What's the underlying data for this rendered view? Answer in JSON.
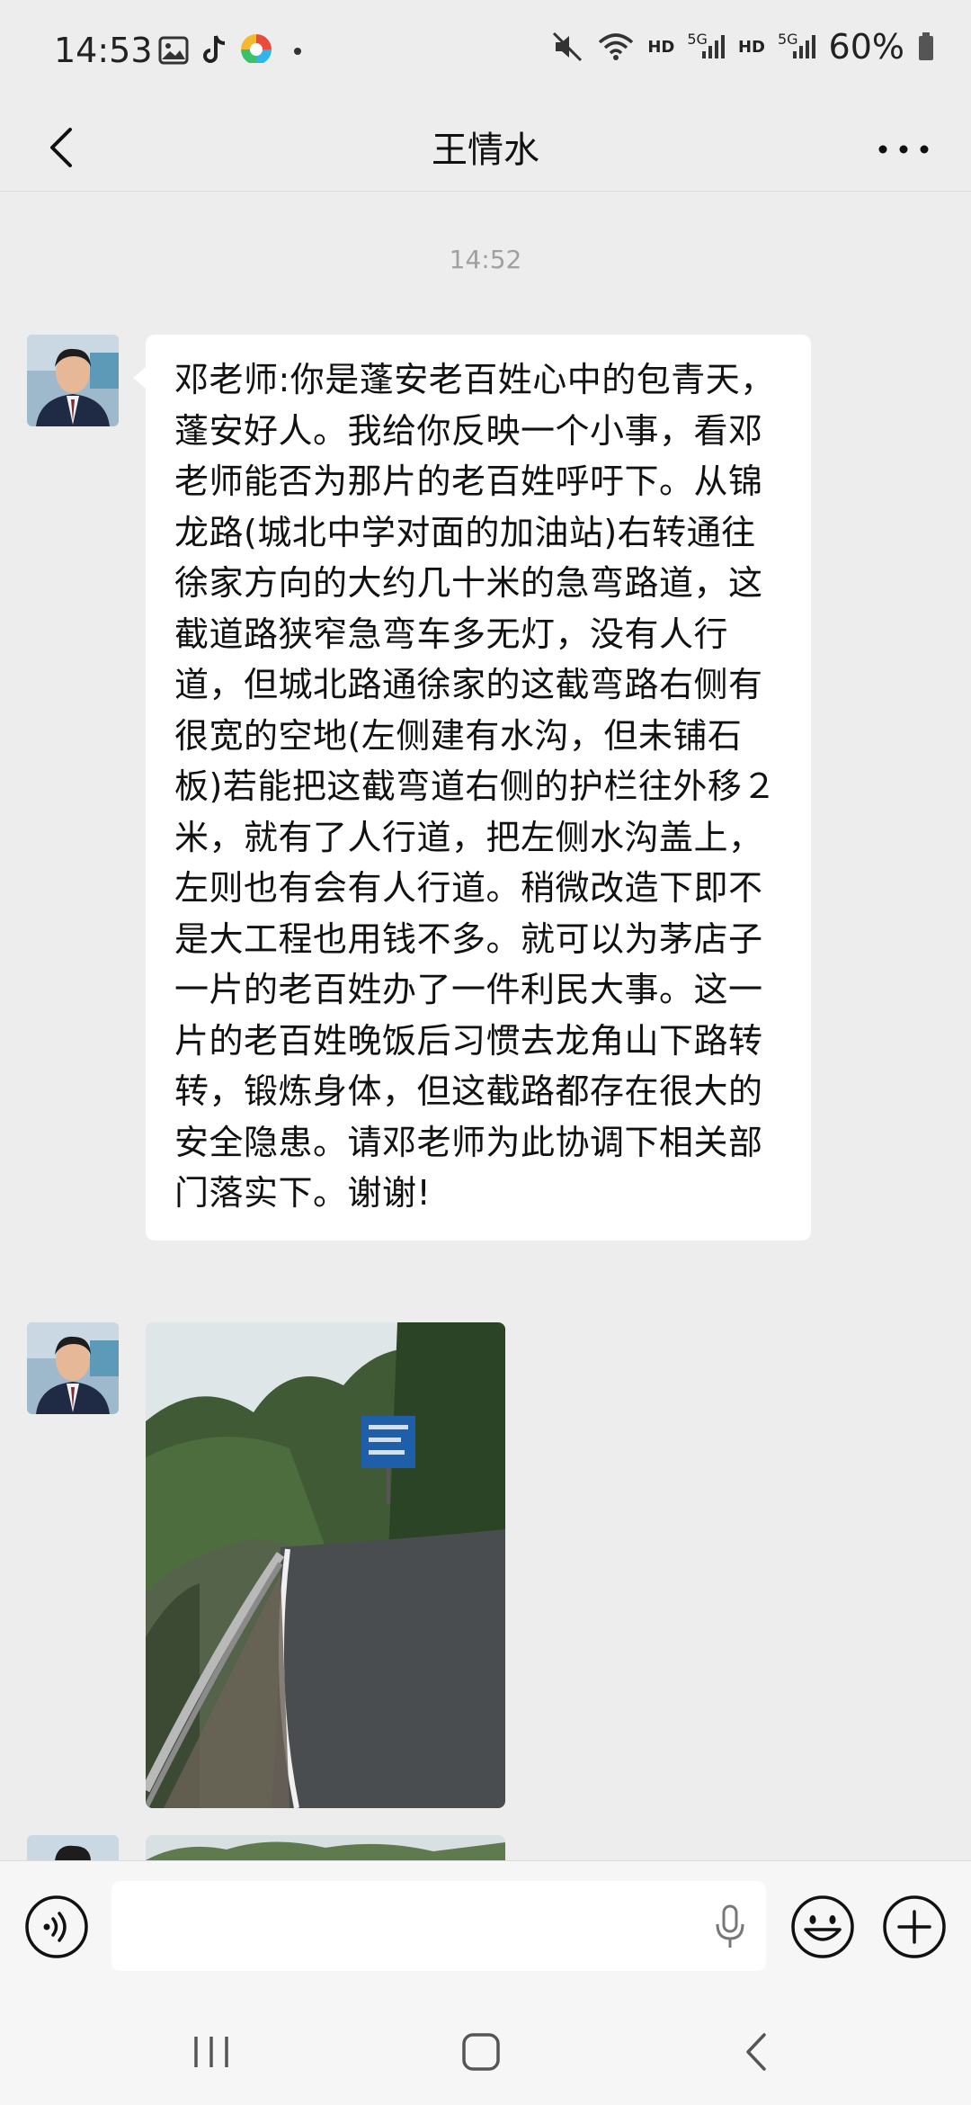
{
  "status_bar": {
    "time": "14:53",
    "app_icons": [
      "gallery-icon",
      "tiktok-icon",
      "app-icon",
      "dot-icon"
    ],
    "signal_labels": [
      "HD",
      "HD"
    ],
    "network_labels": [
      "5G",
      "5G"
    ],
    "battery": "60%"
  },
  "header": {
    "title": "王情水",
    "back_icon": "chevron-left-icon",
    "more_icon": "more-dots-icon"
  },
  "chat": {
    "timestamp": "14:52",
    "messages": [
      {
        "type": "text",
        "text": "邓老师:你是蓬安老百姓心中的包青天，蓬安好人。我给你反映一个小事，看邓老师能否为那片的老百姓呼吁下。从锦龙路(城北中学对面的加油站)右转通往徐家方向的大约几十米的急弯路道，这截道路狭窄急弯车多无灯，没有人行道，但城北路通徐家的这截弯路右侧有很宽的空地(左侧建有水沟，但未铺石板)若能把这截弯道右侧的护栏往外移２米，就有了人行道，把左侧水沟盖上，左则也有会有人行道。稍微改造下即不是大工程也用钱不多。就可以为茅店子一片的老百姓办了一件利民大事。这一片的老百姓晚饭后习惯去龙角山下路转转，锻炼身体，但这截路都存在很大的安全隐患。请邓老师为此协调下相关部门落实下。谢谢!"
      },
      {
        "type": "image",
        "content": "photo of a curved road with guardrail, trees and a blue road sign"
      },
      {
        "type": "image",
        "content": "partially visible photo"
      }
    ]
  },
  "input_bar": {
    "voice_icon": "voice-toggle-icon",
    "mic_icon": "microphone-icon",
    "emoji_icon": "emoji-icon",
    "plus_icon": "plus-icon"
  },
  "nav_bar": {
    "recent_icon": "recent-apps-icon",
    "home_icon": "home-icon",
    "back_icon": "back-icon"
  }
}
